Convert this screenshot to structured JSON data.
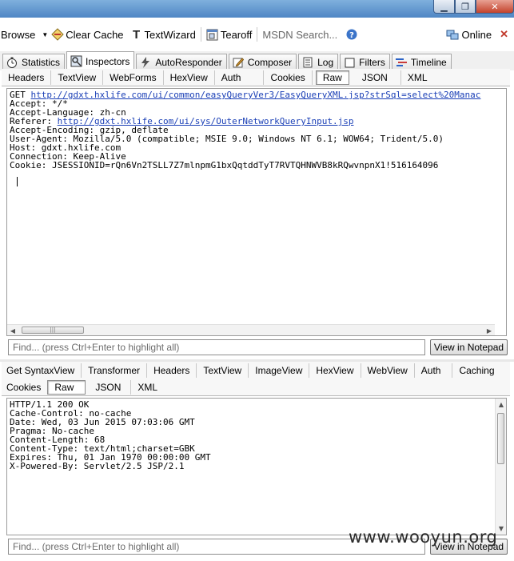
{
  "window": {
    "buttons": {
      "min": "▁",
      "max": "❐",
      "close": "✕"
    }
  },
  "toolbar": {
    "browse_label": "Browse",
    "clear_cache_label": "Clear Cache",
    "textwizard_label": "TextWizard",
    "tearoff_label": "Tearoff",
    "search_placeholder": "MSDN Search...",
    "online_label": "Online",
    "close_glyph": "✕"
  },
  "main_tabs": [
    {
      "label": "Statistics",
      "icon": "stopwatch-icon"
    },
    {
      "label": "Inspectors",
      "icon": "inspectors-icon",
      "active": true
    },
    {
      "label": "AutoResponder",
      "icon": "lightning-icon"
    },
    {
      "label": "Composer",
      "icon": "pencil-icon"
    },
    {
      "label": "Log",
      "icon": "log-icon"
    },
    {
      "label": "Filters",
      "icon": "checkbox-icon"
    },
    {
      "label": "Timeline",
      "icon": "timeline-icon"
    }
  ],
  "request": {
    "tabs": [
      "Headers",
      "TextView",
      "WebForms",
      "HexView",
      "Auth",
      "Cookies",
      "Raw",
      "JSON",
      "XML"
    ],
    "active_tab": "Raw",
    "method": "GET ",
    "url": "http://gdxt.hxlife.com/ui/common/easyQueryVer3/EasyQueryXML.jsp?strSql=select%20Manac",
    "accept": "Accept: */*",
    "accept_language": "Accept-Language: zh-cn",
    "referer_label": "Referer: ",
    "referer_url": "http://gdxt.hxlife.com/ui/sys/OuterNetworkQueryInput.jsp",
    "accept_encoding": "Accept-Encoding: gzip, deflate",
    "user_agent": "User-Agent: Mozilla/5.0 (compatible; MSIE 9.0; Windows NT 6.1; WOW64; Trident/5.0)",
    "host": "Host: gdxt.hxlife.com",
    "connection": "Connection: Keep-Alive",
    "cookie": "Cookie: JSESSIONID=rQn6Vn2TSLL7Z7mlnpmG1bxQqtddTyT7RVTQHNWVB8kRQwvnpnX1!516164096",
    "find_placeholder": "Find... (press Ctrl+Enter to highlight all)",
    "notepad_label": "View in Notepad"
  },
  "response": {
    "tabs_row1": [
      "Get SyntaxView",
      "Transformer",
      "Headers",
      "TextView",
      "ImageView",
      "HexView",
      "WebView",
      "Auth",
      "Caching"
    ],
    "tabs_row2": [
      "Cookies",
      "Raw",
      "JSON",
      "XML"
    ],
    "active_tab": "Raw",
    "lines": [
      "HTTP/1.1 200 OK",
      "Cache-Control: no-cache",
      "Date: Wed, 03 Jun 2015 07:03:06 GMT",
      "Pragma: No-cache",
      "Content-Length: 68",
      "Content-Type: text/html;charset=GBK",
      "Expires: Thu, 01 Jan 1970 00:00:00 GMT",
      "X-Powered-By: Servlet/2.5 JSP/2.1"
    ],
    "find_placeholder": "Find... (press Ctrl+Enter to highlight all)",
    "notepad_label": "View in Notepad"
  },
  "watermark": "www.wooyun.org"
}
